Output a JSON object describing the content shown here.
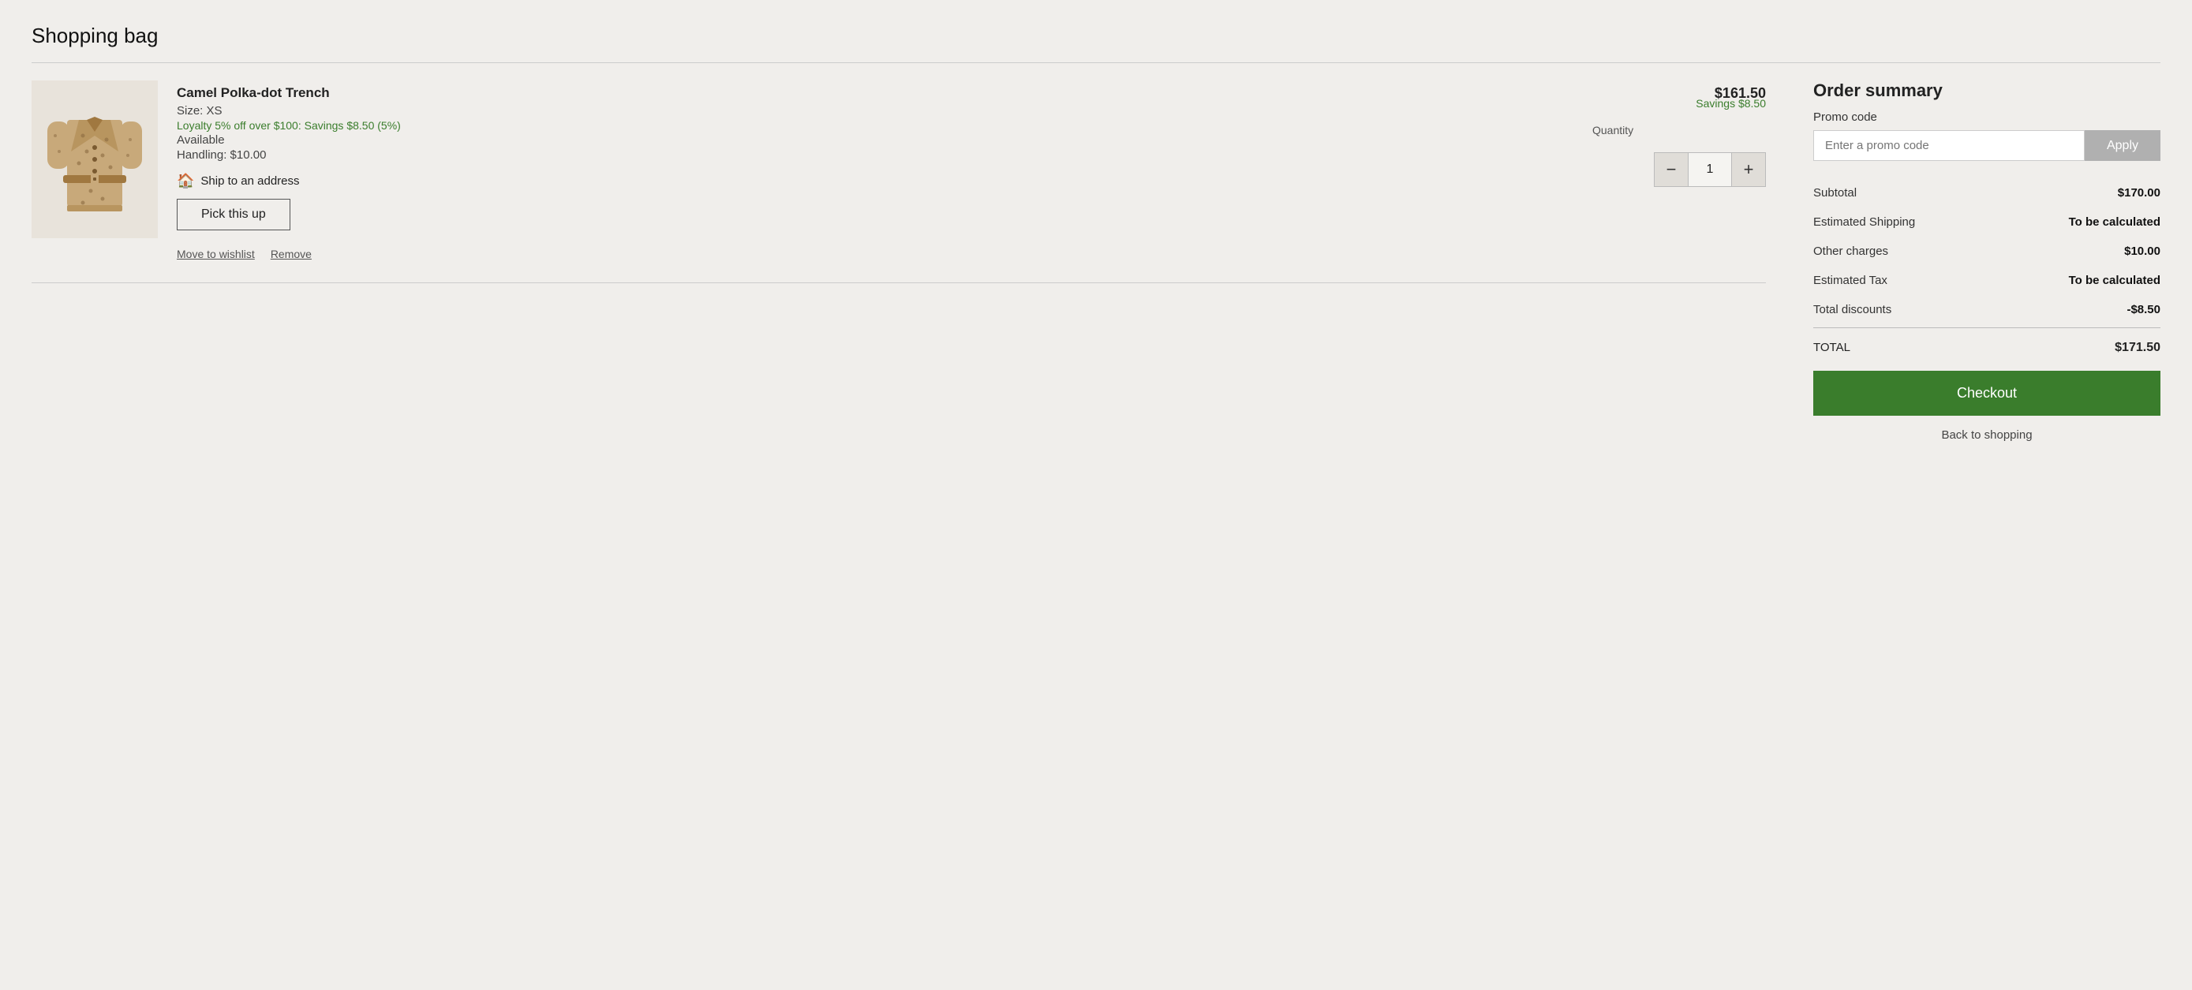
{
  "page": {
    "title": "Shopping bag"
  },
  "item": {
    "name": "Camel Polka-dot Trench",
    "size": "Size: XS",
    "loyalty": "Loyalty 5% off over $100: Savings $8.50 (5%)",
    "availability": "Available",
    "handling": "Handling: $10.00",
    "ship_label": "Ship to an address",
    "pick_up_label": "Pick this up",
    "move_to_wishlist": "Move to wishlist",
    "remove": "Remove",
    "quantity": "1",
    "quantity_label": "Quantity",
    "price": "$161.50",
    "savings": "Savings $8.50"
  },
  "order_summary": {
    "title": "Order summary",
    "promo_label": "Promo code",
    "promo_placeholder": "Enter a promo code",
    "apply_label": "Apply",
    "rows": [
      {
        "label": "Subtotal",
        "value": "$170.00",
        "bold": true
      },
      {
        "label": "Estimated Shipping",
        "value": "To be calculated",
        "bold": true
      },
      {
        "label": "Other charges",
        "value": "$10.00",
        "bold": true
      },
      {
        "label": "Estimated Tax",
        "value": "To be calculated",
        "bold": true
      },
      {
        "label": "Total discounts",
        "value": "-$8.50",
        "bold": true
      }
    ],
    "total_label": "TOTAL",
    "total_value": "$171.50",
    "checkout_label": "Checkout",
    "back_shopping": "Back to shopping"
  }
}
